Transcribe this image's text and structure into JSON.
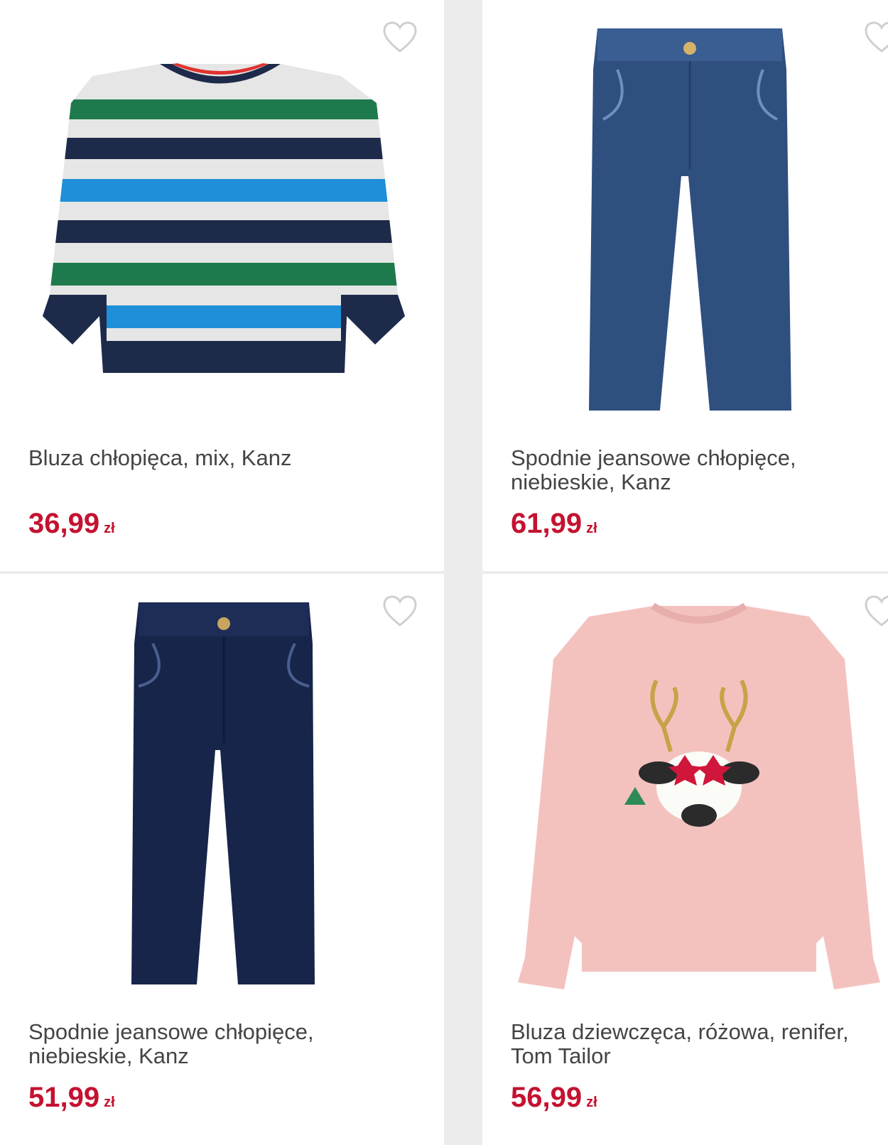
{
  "products": [
    {
      "name": "Bluza chłopięca, mix, Kanz",
      "price": "36,99",
      "currency": "zł",
      "image": "striped-sweatshirt"
    },
    {
      "name": "Spodnie jeansowe chłopięce, niebieskie, Kanz",
      "price": "61,99",
      "currency": "zł",
      "image": "light-blue-jeans"
    },
    {
      "name": "Spodnie jeansowe chłopięce, niebieskie, Kanz",
      "price": "51,99",
      "currency": "zł",
      "image": "dark-blue-jeans"
    },
    {
      "name": "Bluza dziewczęca, różowa, renifer, Tom Tailor",
      "price": "56,99",
      "currency": "zł",
      "image": "pink-reindeer-sweatshirt"
    }
  ],
  "icons": {
    "favorite": "heart-outline-icon"
  },
  "colors": {
    "price": "#c41230",
    "background": "#ececec",
    "card": "#ffffff"
  }
}
